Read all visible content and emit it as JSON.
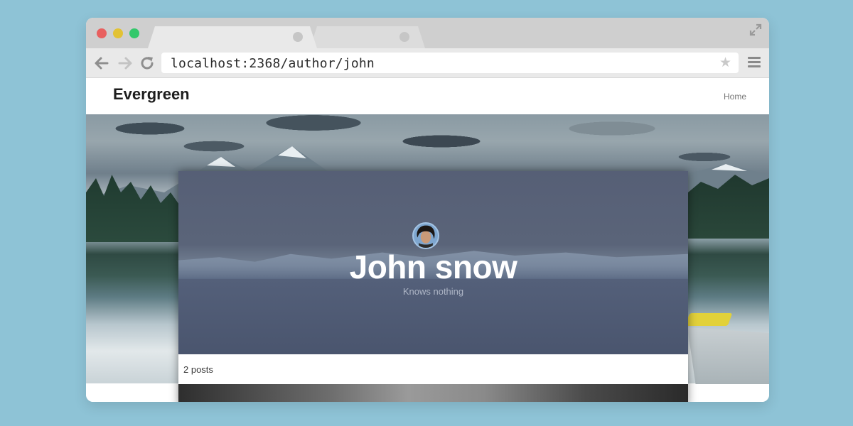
{
  "browser": {
    "url": "localhost:2368/author/john",
    "colors": {
      "close": "#e8605f",
      "minimize": "#e2c234",
      "zoom": "#33c86b"
    }
  },
  "site": {
    "title": "Evergreen",
    "nav": {
      "home": "Home"
    }
  },
  "author": {
    "name": "John snow",
    "bio": "Knows nothing",
    "post_count": "2 posts"
  }
}
